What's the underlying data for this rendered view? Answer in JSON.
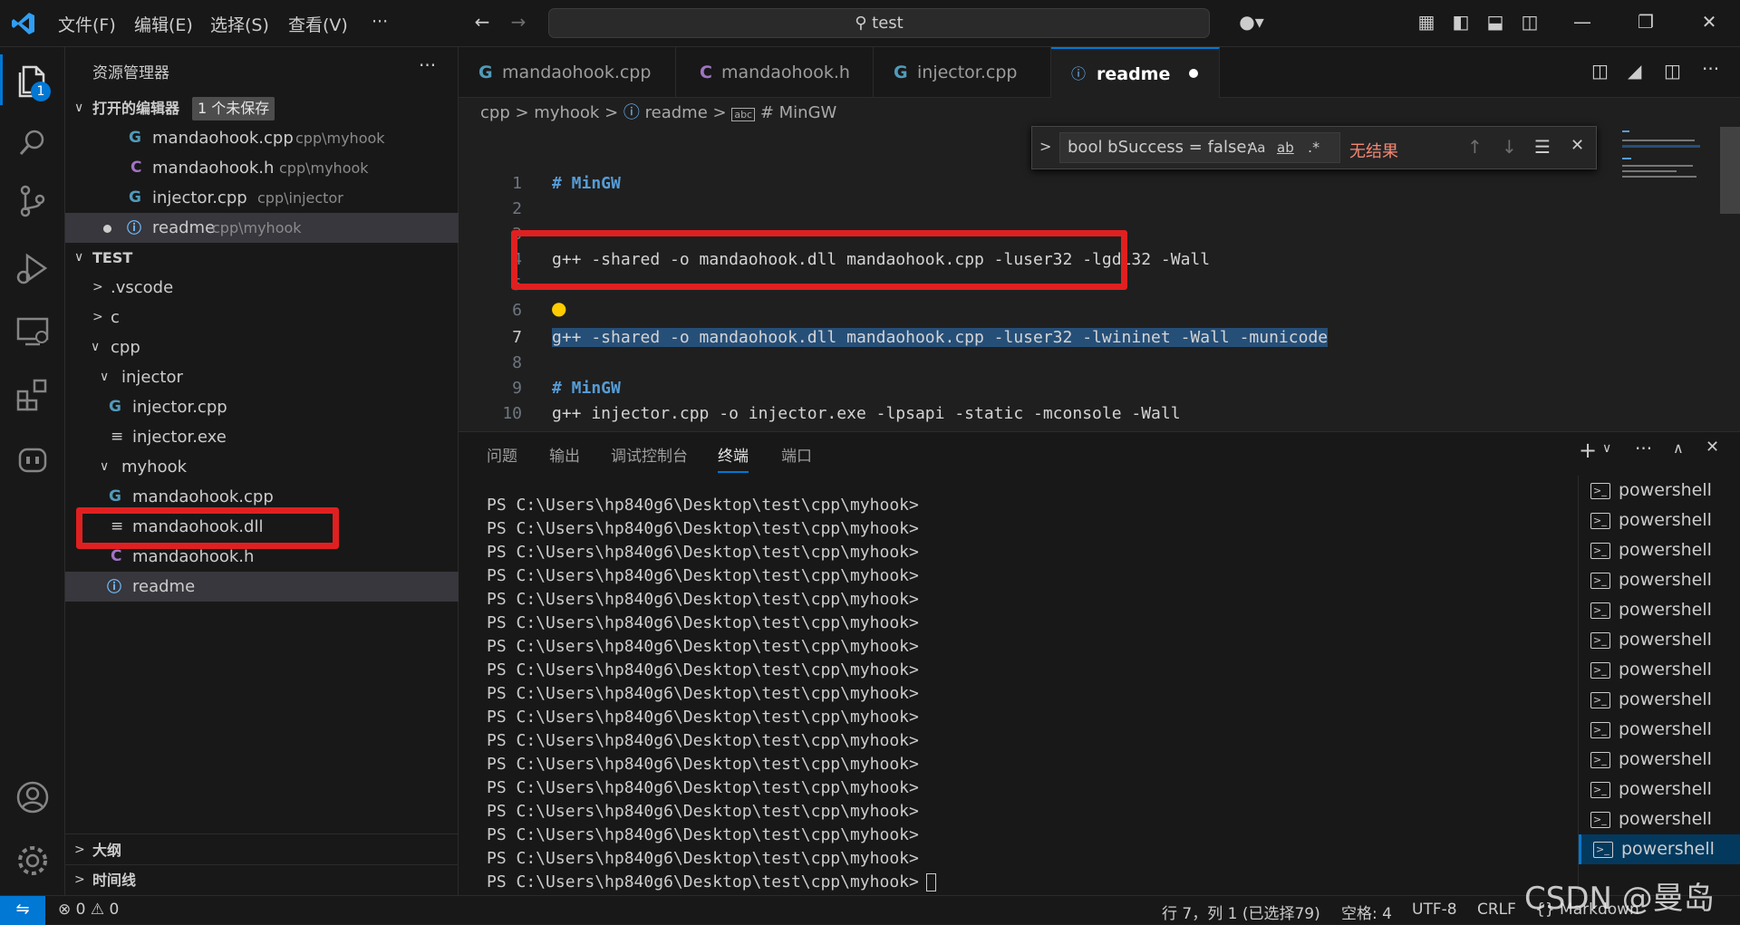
{
  "titlebar": {
    "menus": [
      "文件(F)",
      "编辑(E)",
      "选择(S)",
      "查看(V)",
      "···"
    ],
    "search_text": "test"
  },
  "activitybar": {
    "explorer_badge": "1"
  },
  "sidebar": {
    "title": "资源管理器",
    "open_editors": {
      "label": "打开的编辑器",
      "badge": "1 个未保存",
      "items": [
        {
          "name": "mandaohook.cpp",
          "path": "cpp\\myhook"
        },
        {
          "name": "mandaohook.h",
          "path": "cpp\\myhook"
        },
        {
          "name": "injector.cpp",
          "path": "cpp\\injector"
        },
        {
          "name": "readme",
          "path": "cpp\\myhook"
        }
      ]
    },
    "workspace": {
      "label": "TEST",
      "folders": [
        ".vscode",
        "c",
        "cpp",
        "injector",
        "myhook"
      ],
      "files": [
        "injector.cpp",
        "injector.exe",
        "mandaohook.cpp",
        "mandaohook.dll",
        "mandaohook.h",
        "readme"
      ]
    },
    "outline_label": "大纲",
    "timeline_label": "时间线"
  },
  "tabs": [
    {
      "label": "mandaohook.cpp"
    },
    {
      "label": "mandaohook.h"
    },
    {
      "label": "injector.cpp"
    },
    {
      "label": "readme"
    }
  ],
  "breadcrumb": [
    "cpp",
    "myhook",
    "readme",
    "# MinGW"
  ],
  "find": {
    "query": "bool bSuccess = false;",
    "opt_case": "Aa",
    "opt_word": "ab",
    "opt_regex": ".*",
    "result": "无结果"
  },
  "editor": {
    "line_numbers": [
      "1",
      "2",
      "3",
      "4",
      "5",
      "6",
      "7",
      "8",
      "9",
      "10"
    ],
    "lines": [
      "# MinGW",
      "",
      "",
      "g++ -shared -o mandaohook.dll mandaohook.cpp -luser32 -lgdi32 -Wall",
      "",
      "",
      "g++ -shared -o mandaohook.dll mandaohook.cpp -luser32 -lwininet -Wall -municode",
      "",
      "# MinGW",
      "g++ injector.cpp -o injector.exe -lpsapi -static -mconsole -Wall"
    ]
  },
  "panel": {
    "tabs": [
      "问题",
      "输出",
      "调试控制台",
      "终端",
      "端口"
    ],
    "active_tab": "终端",
    "terminal_prompt": "PS C:\\Users\\hp840g6\\Desktop\\test\\cpp\\myhook>",
    "terminals": [
      "powershell",
      "powershell",
      "powershell",
      "powershell",
      "powershell",
      "powershell",
      "powershell",
      "powershell",
      "powershell",
      "powershell",
      "powershell",
      "powershell",
      "powershell"
    ]
  },
  "statusbar": {
    "errors": "0",
    "warnings": "0",
    "position": "行 7，列 1 (已选择79)",
    "spaces": "空格: 4",
    "encoding": "UTF-8",
    "eol": "CRLF",
    "language": "Markdown"
  },
  "watermark": "CSDN @曼岛",
  "colors": {
    "accent": "#0078d4",
    "annotation_red": "#e02020",
    "cpp_icon": "#519aba",
    "h_icon": "#a074c4",
    "info_icon": "#75beff"
  }
}
